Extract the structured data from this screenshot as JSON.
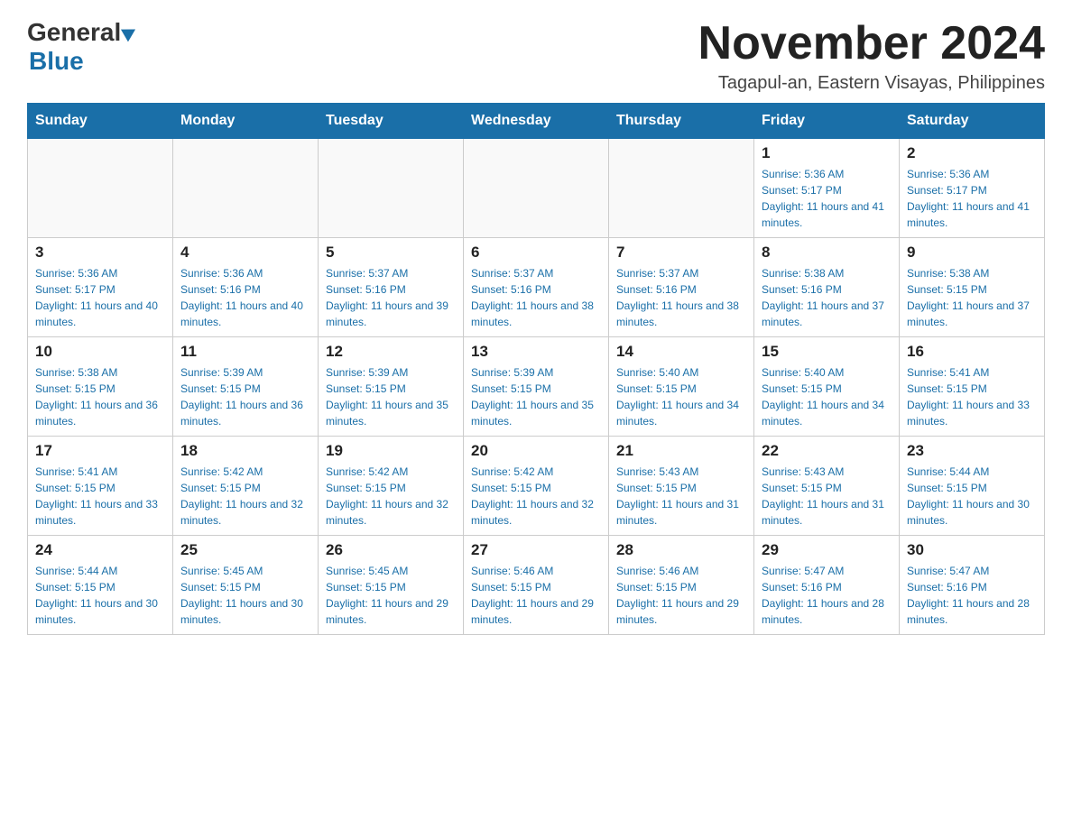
{
  "logo": {
    "general": "General",
    "blue": "Blue"
  },
  "header": {
    "month_year": "November 2024",
    "location": "Tagapul-an, Eastern Visayas, Philippines"
  },
  "days_of_week": [
    "Sunday",
    "Monday",
    "Tuesday",
    "Wednesday",
    "Thursday",
    "Friday",
    "Saturday"
  ],
  "weeks": [
    [
      {
        "day": "",
        "sunrise": "",
        "sunset": "",
        "daylight": ""
      },
      {
        "day": "",
        "sunrise": "",
        "sunset": "",
        "daylight": ""
      },
      {
        "day": "",
        "sunrise": "",
        "sunset": "",
        "daylight": ""
      },
      {
        "day": "",
        "sunrise": "",
        "sunset": "",
        "daylight": ""
      },
      {
        "day": "",
        "sunrise": "",
        "sunset": "",
        "daylight": ""
      },
      {
        "day": "1",
        "sunrise": "Sunrise: 5:36 AM",
        "sunset": "Sunset: 5:17 PM",
        "daylight": "Daylight: 11 hours and 41 minutes."
      },
      {
        "day": "2",
        "sunrise": "Sunrise: 5:36 AM",
        "sunset": "Sunset: 5:17 PM",
        "daylight": "Daylight: 11 hours and 41 minutes."
      }
    ],
    [
      {
        "day": "3",
        "sunrise": "Sunrise: 5:36 AM",
        "sunset": "Sunset: 5:17 PM",
        "daylight": "Daylight: 11 hours and 40 minutes."
      },
      {
        "day": "4",
        "sunrise": "Sunrise: 5:36 AM",
        "sunset": "Sunset: 5:16 PM",
        "daylight": "Daylight: 11 hours and 40 minutes."
      },
      {
        "day": "5",
        "sunrise": "Sunrise: 5:37 AM",
        "sunset": "Sunset: 5:16 PM",
        "daylight": "Daylight: 11 hours and 39 minutes."
      },
      {
        "day": "6",
        "sunrise": "Sunrise: 5:37 AM",
        "sunset": "Sunset: 5:16 PM",
        "daylight": "Daylight: 11 hours and 38 minutes."
      },
      {
        "day": "7",
        "sunrise": "Sunrise: 5:37 AM",
        "sunset": "Sunset: 5:16 PM",
        "daylight": "Daylight: 11 hours and 38 minutes."
      },
      {
        "day": "8",
        "sunrise": "Sunrise: 5:38 AM",
        "sunset": "Sunset: 5:16 PM",
        "daylight": "Daylight: 11 hours and 37 minutes."
      },
      {
        "day": "9",
        "sunrise": "Sunrise: 5:38 AM",
        "sunset": "Sunset: 5:15 PM",
        "daylight": "Daylight: 11 hours and 37 minutes."
      }
    ],
    [
      {
        "day": "10",
        "sunrise": "Sunrise: 5:38 AM",
        "sunset": "Sunset: 5:15 PM",
        "daylight": "Daylight: 11 hours and 36 minutes."
      },
      {
        "day": "11",
        "sunrise": "Sunrise: 5:39 AM",
        "sunset": "Sunset: 5:15 PM",
        "daylight": "Daylight: 11 hours and 36 minutes."
      },
      {
        "day": "12",
        "sunrise": "Sunrise: 5:39 AM",
        "sunset": "Sunset: 5:15 PM",
        "daylight": "Daylight: 11 hours and 35 minutes."
      },
      {
        "day": "13",
        "sunrise": "Sunrise: 5:39 AM",
        "sunset": "Sunset: 5:15 PM",
        "daylight": "Daylight: 11 hours and 35 minutes."
      },
      {
        "day": "14",
        "sunrise": "Sunrise: 5:40 AM",
        "sunset": "Sunset: 5:15 PM",
        "daylight": "Daylight: 11 hours and 34 minutes."
      },
      {
        "day": "15",
        "sunrise": "Sunrise: 5:40 AM",
        "sunset": "Sunset: 5:15 PM",
        "daylight": "Daylight: 11 hours and 34 minutes."
      },
      {
        "day": "16",
        "sunrise": "Sunrise: 5:41 AM",
        "sunset": "Sunset: 5:15 PM",
        "daylight": "Daylight: 11 hours and 33 minutes."
      }
    ],
    [
      {
        "day": "17",
        "sunrise": "Sunrise: 5:41 AM",
        "sunset": "Sunset: 5:15 PM",
        "daylight": "Daylight: 11 hours and 33 minutes."
      },
      {
        "day": "18",
        "sunrise": "Sunrise: 5:42 AM",
        "sunset": "Sunset: 5:15 PM",
        "daylight": "Daylight: 11 hours and 32 minutes."
      },
      {
        "day": "19",
        "sunrise": "Sunrise: 5:42 AM",
        "sunset": "Sunset: 5:15 PM",
        "daylight": "Daylight: 11 hours and 32 minutes."
      },
      {
        "day": "20",
        "sunrise": "Sunrise: 5:42 AM",
        "sunset": "Sunset: 5:15 PM",
        "daylight": "Daylight: 11 hours and 32 minutes."
      },
      {
        "day": "21",
        "sunrise": "Sunrise: 5:43 AM",
        "sunset": "Sunset: 5:15 PM",
        "daylight": "Daylight: 11 hours and 31 minutes."
      },
      {
        "day": "22",
        "sunrise": "Sunrise: 5:43 AM",
        "sunset": "Sunset: 5:15 PM",
        "daylight": "Daylight: 11 hours and 31 minutes."
      },
      {
        "day": "23",
        "sunrise": "Sunrise: 5:44 AM",
        "sunset": "Sunset: 5:15 PM",
        "daylight": "Daylight: 11 hours and 30 minutes."
      }
    ],
    [
      {
        "day": "24",
        "sunrise": "Sunrise: 5:44 AM",
        "sunset": "Sunset: 5:15 PM",
        "daylight": "Daylight: 11 hours and 30 minutes."
      },
      {
        "day": "25",
        "sunrise": "Sunrise: 5:45 AM",
        "sunset": "Sunset: 5:15 PM",
        "daylight": "Daylight: 11 hours and 30 minutes."
      },
      {
        "day": "26",
        "sunrise": "Sunrise: 5:45 AM",
        "sunset": "Sunset: 5:15 PM",
        "daylight": "Daylight: 11 hours and 29 minutes."
      },
      {
        "day": "27",
        "sunrise": "Sunrise: 5:46 AM",
        "sunset": "Sunset: 5:15 PM",
        "daylight": "Daylight: 11 hours and 29 minutes."
      },
      {
        "day": "28",
        "sunrise": "Sunrise: 5:46 AM",
        "sunset": "Sunset: 5:15 PM",
        "daylight": "Daylight: 11 hours and 29 minutes."
      },
      {
        "day": "29",
        "sunrise": "Sunrise: 5:47 AM",
        "sunset": "Sunset: 5:16 PM",
        "daylight": "Daylight: 11 hours and 28 minutes."
      },
      {
        "day": "30",
        "sunrise": "Sunrise: 5:47 AM",
        "sunset": "Sunset: 5:16 PM",
        "daylight": "Daylight: 11 hours and 28 minutes."
      }
    ]
  ]
}
